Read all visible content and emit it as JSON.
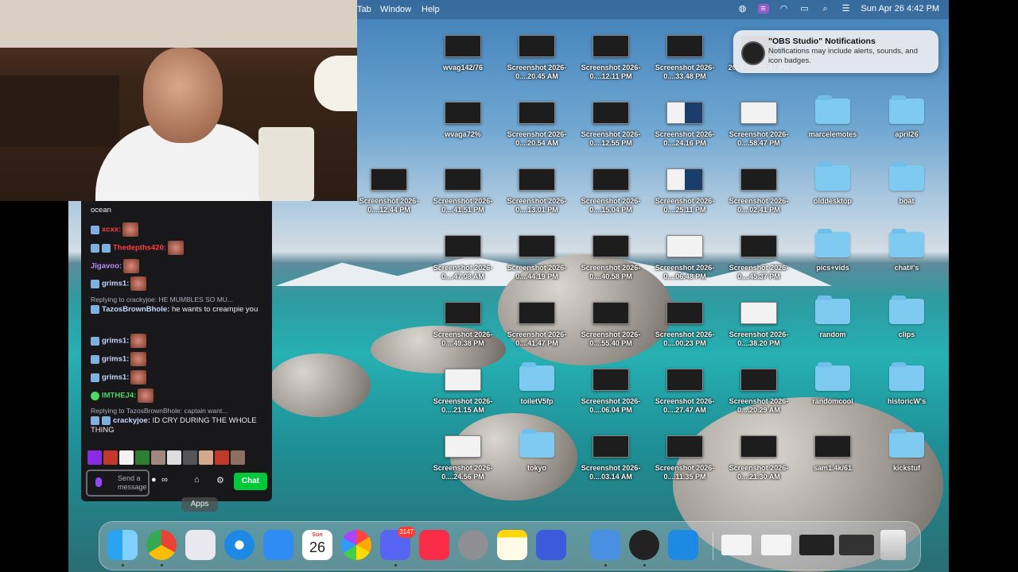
{
  "menubar": {
    "items": [
      "Tab",
      "Window",
      "Help"
    ],
    "clock": "Sun Apr 26  4:42 PM"
  },
  "notification": {
    "title": "\"OBS Studio\" Notifications",
    "body": "Notifications may include alerts, sounds, and icon badges."
  },
  "desktop_icons": [
    {
      "label": "wvag142/76",
      "kind": "dark"
    },
    {
      "label": "Screenshot 2026-0....20.45 AM",
      "kind": "dark"
    },
    {
      "label": "Screenshot 2026-0....12.11 PM",
      "kind": "dark"
    },
    {
      "label": "Screenshot 2026-0....33.48 PM",
      "kind": "dark"
    },
    {
      "label": "2026-0....32.47 PM",
      "kind": "dark"
    },
    {
      "label": "wvaga72%",
      "kind": "dark"
    },
    {
      "label": "Screenshot 2026-0....20.54 AM",
      "kind": "dark"
    },
    {
      "label": "Screenshot 2026-0....12.55 PM",
      "kind": "dark"
    },
    {
      "label": "Screenshot 2026-0....24.16 PM",
      "kind": "mixed"
    },
    {
      "label": "Screenshot 2026-0....58.47 PM",
      "kind": "light"
    },
    {
      "label": "marcelemotes",
      "kind": "folder"
    },
    {
      "label": "april26",
      "kind": "folder"
    },
    {
      "label": "Screenshot 2026-0....12.44 PM",
      "kind": "dark"
    },
    {
      "label": "Screenshot 2026-0....41.51 PM",
      "kind": "dark"
    },
    {
      "label": "Screenshot 2026-0....13.01 PM",
      "kind": "dark"
    },
    {
      "label": "Screenshot 2026-0....15.04 PM",
      "kind": "dark"
    },
    {
      "label": "Screenshot 2026-0....25.11 PM",
      "kind": "mixed"
    },
    {
      "label": "Screenshot 2026-0....02.41 PM",
      "kind": "dark"
    },
    {
      "label": "olddesktop",
      "kind": "folder"
    },
    {
      "label": "boat",
      "kind": "folder"
    },
    {
      "label": "Screenshot 2026-0....47.08 AM",
      "kind": "dark"
    },
    {
      "label": "Screenshot 2026-0....44.19 PM",
      "kind": "dark"
    },
    {
      "label": "Screenshot 2026-0....40.58 PM",
      "kind": "dark"
    },
    {
      "label": "Screenshot 2026-0....06.48 PM",
      "kind": "light"
    },
    {
      "label": "Screenshot 2026-0....45.37 PM",
      "kind": "dark"
    },
    {
      "label": "pics+vids",
      "kind": "folder"
    },
    {
      "label": "chat#'s",
      "kind": "folder"
    },
    {
      "label": "Screenshot 2026-0....49.38 PM",
      "kind": "dark"
    },
    {
      "label": "Screenshot 2026-0....41.47 PM",
      "kind": "dark"
    },
    {
      "label": "Screenshot 2026-0....55.40 PM",
      "kind": "dark"
    },
    {
      "label": "Screenshot 2026-0....00.23 PM",
      "kind": "dark"
    },
    {
      "label": "Screenshot 2026-0....38.20 PM",
      "kind": "light"
    },
    {
      "label": "random",
      "kind": "folder"
    },
    {
      "label": "clips",
      "kind": "folder"
    },
    {
      "label": "Screenshot 2026-0....21.15 AM",
      "kind": "light"
    },
    {
      "label": "toiletV5fp",
      "kind": "folder"
    },
    {
      "label": "Screenshot 2026-0....06.04 PM",
      "kind": "dark"
    },
    {
      "label": "Screenshot 2026-0....27.47 AM",
      "kind": "dark"
    },
    {
      "label": "Screenshot 2026-0....20.29 AM",
      "kind": "dark"
    },
    {
      "label": "randomcool",
      "kind": "folder"
    },
    {
      "label": "historicW's",
      "kind": "folder"
    },
    {
      "label": "Screenshot 2026-0....24.56 PM",
      "kind": "light"
    },
    {
      "label": "tokyo",
      "kind": "folder"
    },
    {
      "label": "Screenshot 2026-0....03.14 AM",
      "kind": "dark"
    },
    {
      "label": "Screenshot 2026-0....11.35 PM",
      "kind": "dark"
    },
    {
      "label": "Screenshot 2026-0....21.30 AM",
      "kind": "dark"
    },
    {
      "label": "sam1.4k/61",
      "kind": "dark"
    },
    {
      "label": "kickstuf",
      "kind": "folder"
    }
  ],
  "chat": {
    "messages": [
      {
        "user": "",
        "text": "ocean"
      },
      {
        "user": "xcxx:",
        "text": ""
      },
      {
        "user": "Thedepths420:",
        "text": ""
      },
      {
        "user": "Jigavoo:",
        "text": ""
      },
      {
        "user": "grims1:",
        "text": ""
      },
      {
        "user": "",
        "text": "Replying to crackyjoe: HE MUMBLES SO MU..."
      },
      {
        "user": "TazosBrownBhole:",
        "text": "he wants to creampie you"
      },
      {
        "user": "grims1:",
        "text": ""
      },
      {
        "user": "grims1:",
        "text": ""
      },
      {
        "user": "grims1:",
        "text": ""
      },
      {
        "user": "IMTHEJ4:",
        "text": ""
      },
      {
        "user": "",
        "text": "Replying to TazosBrownBhole: captain want..."
      },
      {
        "user": "crackyjoe:",
        "text": "ID CRY DURING THE WHOLE THING"
      }
    ],
    "input_placeholder": "Send a message",
    "send_label": "Chat"
  },
  "tooltip": "Apps",
  "dock": {
    "calendar_month": "Sun",
    "calendar_day": "26",
    "discord_badge": "3147",
    "apps": [
      "Finder",
      "Chrome",
      "Launchpad",
      "Safari",
      "Mail",
      "Calendar",
      "Photos",
      "Discord",
      "Music",
      "System Settings",
      "Notes",
      "Simulator",
      "Streamlabs",
      "OBS",
      "QuickTime",
      "Trash"
    ]
  },
  "colors": {
    "chat_bg": "#18181b",
    "chat_send": "#00c83a",
    "user_red": "#ff3d3d",
    "user_green": "#4cd964"
  }
}
